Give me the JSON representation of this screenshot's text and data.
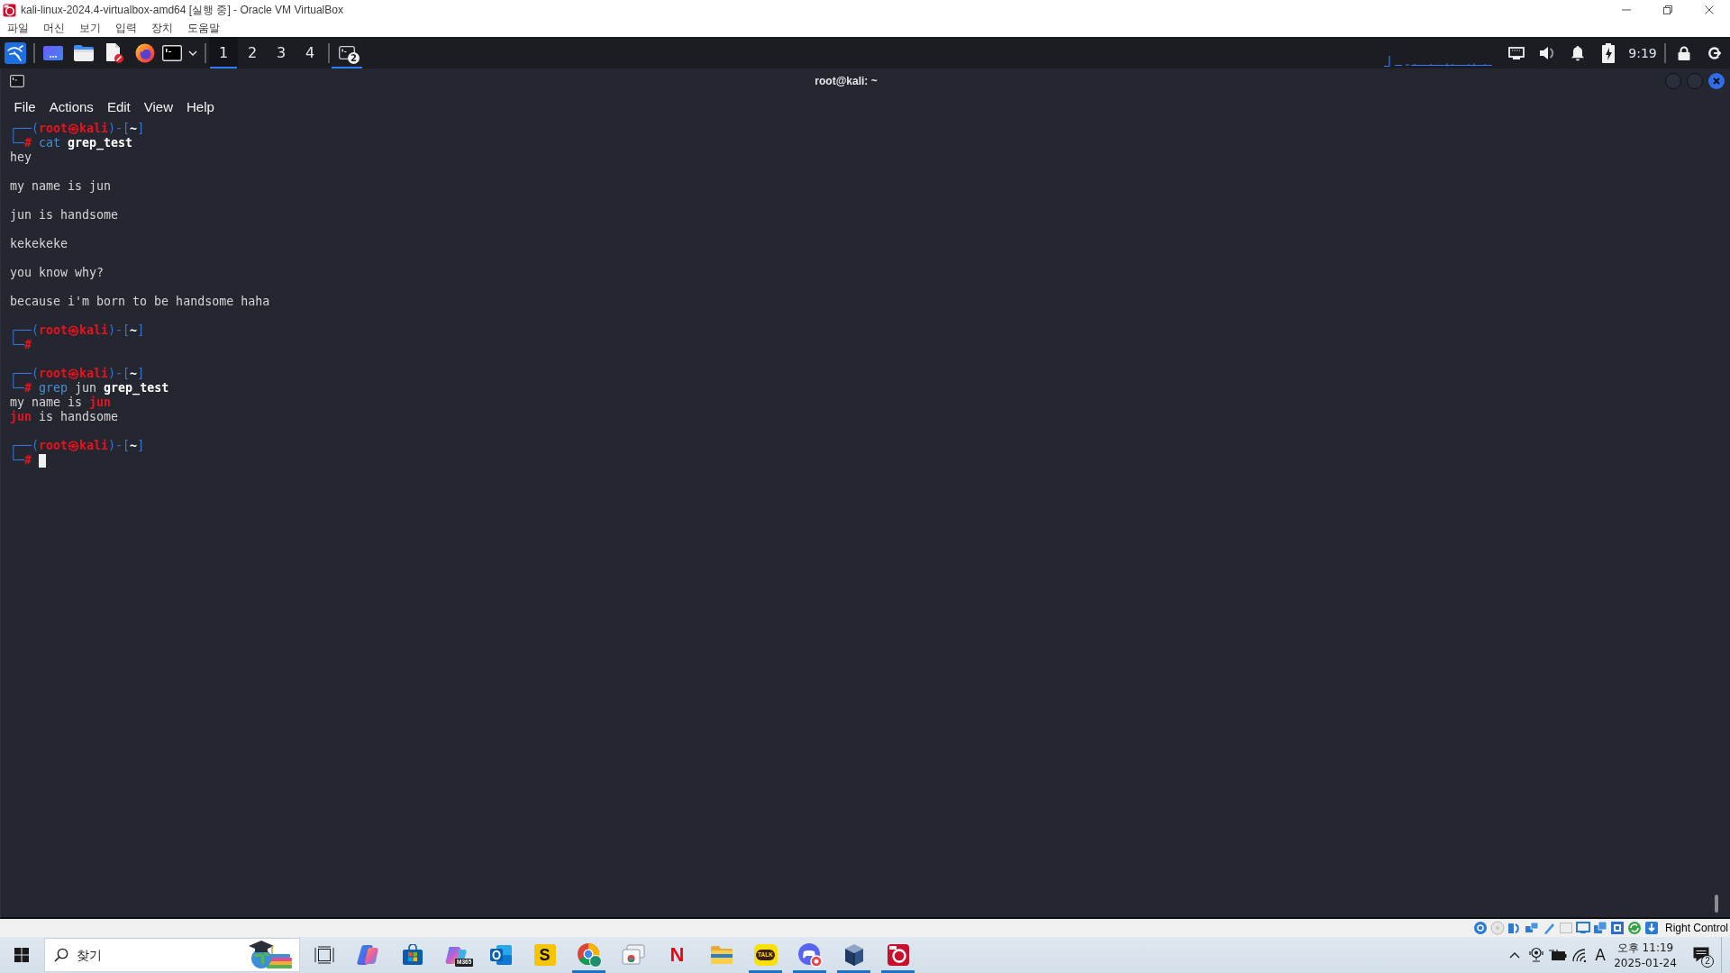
{
  "window": {
    "title": "kali-linux-2024.4-virtualbox-amd64 [실행 중] - Oracle VM VirtualBox"
  },
  "menu": [
    "파일",
    "머신",
    "보기",
    "입력",
    "장치",
    "도움말"
  ],
  "panel": {
    "workspaces": [
      {
        "label": "1",
        "selected": true
      },
      {
        "label": "2",
        "selected": false
      },
      {
        "label": "3",
        "selected": false
      },
      {
        "label": "4",
        "selected": false
      }
    ],
    "tasks": [
      {
        "badge": "2",
        "selected": true
      }
    ],
    "clock": "9:19"
  },
  "terminal": {
    "title": "root@kali: ~",
    "menu": [
      "File",
      "Actions",
      "Edit",
      "View",
      "Help"
    ],
    "entries": [
      {
        "prompt": [
          {
            "text": "┌──(",
            "kind": "frame"
          },
          {
            "text": "root㉿kali",
            "kind": "user"
          },
          {
            "text": ")-[",
            "kind": "frame"
          },
          {
            "text": "~",
            "kind": "path"
          },
          {
            "text": "]",
            "kind": "frame"
          }
        ],
        "command": [
          {
            "text": "└─",
            "kind": "frame"
          },
          {
            "text": "#",
            "kind": "root"
          },
          {
            "text": " cat",
            "kind": "program"
          },
          {
            "text": " grep_test",
            "kind": "file"
          }
        ],
        "cursor": false,
        "output": [
          {
            "kind": "text",
            "segments": [
              {
                "text": "hey",
                "kind": "plain"
              }
            ]
          },
          {
            "kind": "blank"
          },
          {
            "kind": "text",
            "segments": [
              {
                "text": "my name is jun",
                "kind": "plain"
              }
            ]
          },
          {
            "kind": "blank"
          },
          {
            "kind": "text",
            "segments": [
              {
                "text": "jun is handsome",
                "kind": "plain"
              }
            ]
          },
          {
            "kind": "blank"
          },
          {
            "kind": "text",
            "segments": [
              {
                "text": "kekekeke",
                "kind": "plain"
              }
            ]
          },
          {
            "kind": "blank"
          },
          {
            "kind": "text",
            "segments": [
              {
                "text": "you know why?",
                "kind": "plain"
              }
            ]
          },
          {
            "kind": "blank"
          },
          {
            "kind": "text",
            "segments": [
              {
                "text": "because i'm born to be handsome haha",
                "kind": "plain"
              }
            ]
          }
        ]
      },
      {
        "prompt": [
          {
            "text": "┌──(",
            "kind": "frame"
          },
          {
            "text": "root㉿kali",
            "kind": "user"
          },
          {
            "text": ")-[",
            "kind": "frame"
          },
          {
            "text": "~",
            "kind": "path"
          },
          {
            "text": "]",
            "kind": "frame"
          }
        ],
        "command": [
          {
            "text": "└─",
            "kind": "frame"
          },
          {
            "text": "#",
            "kind": "root"
          }
        ],
        "cursor": false
      },
      {
        "prompt": [
          {
            "text": "┌──(",
            "kind": "frame"
          },
          {
            "text": "root㉿kali",
            "kind": "user"
          },
          {
            "text": ")-[",
            "kind": "frame"
          },
          {
            "text": "~",
            "kind": "path"
          },
          {
            "text": "]",
            "kind": "frame"
          }
        ],
        "command": [
          {
            "text": "└─",
            "kind": "frame"
          },
          {
            "text": "#",
            "kind": "root"
          },
          {
            "text": " grep",
            "kind": "program"
          },
          {
            "text": " jun",
            "kind": "arg"
          },
          {
            "text": " grep_test",
            "kind": "file"
          }
        ],
        "cursor": false,
        "output": [
          {
            "kind": "text",
            "segments": [
              {
                "text": "my name is ",
                "kind": "plain"
              },
              {
                "text": "jun",
                "kind": "match"
              }
            ]
          },
          {
            "kind": "text",
            "segments": [
              {
                "text": "jun",
                "kind": "match"
              },
              {
                "text": " is handsome",
                "kind": "plain"
              }
            ]
          }
        ]
      },
      {
        "prompt": [
          {
            "text": "┌──(",
            "kind": "frame"
          },
          {
            "text": "root㉿kali",
            "kind": "user"
          },
          {
            "text": ")-[",
            "kind": "frame"
          },
          {
            "text": "~",
            "kind": "path"
          },
          {
            "text": "]",
            "kind": "frame"
          }
        ],
        "command": [
          {
            "text": "└─",
            "kind": "frame"
          },
          {
            "text": "#",
            "kind": "root"
          }
        ],
        "cursor": true
      }
    ]
  },
  "vm_status": {
    "host_key": "Right Control"
  },
  "taskbar": {
    "search": {
      "placeholder": "찾기"
    },
    "apps": [
      {
        "kind": "taskview",
        "running": false
      },
      {
        "kind": "copilot",
        "running": false
      },
      {
        "kind": "store",
        "running": false
      },
      {
        "kind": "m365",
        "label": "M365",
        "running": false
      },
      {
        "kind": "outlook",
        "running": false
      },
      {
        "kind": "tile",
        "label": "S",
        "running": false
      },
      {
        "kind": "chrome",
        "running": true
      },
      {
        "kind": "remote",
        "running": false
      },
      {
        "kind": "letter",
        "label": "N",
        "running": false
      },
      {
        "kind": "explorer",
        "running": false
      },
      {
        "kind": "talk",
        "label": "TALK",
        "running": true
      },
      {
        "kind": "chat",
        "running": true
      },
      {
        "kind": "cube",
        "running": true
      },
      {
        "kind": "vm",
        "running": true
      }
    ],
    "tray": {
      "input": "A",
      "time": "오후 11:19",
      "date": "2025-01-24",
      "notifications": "2"
    }
  }
}
